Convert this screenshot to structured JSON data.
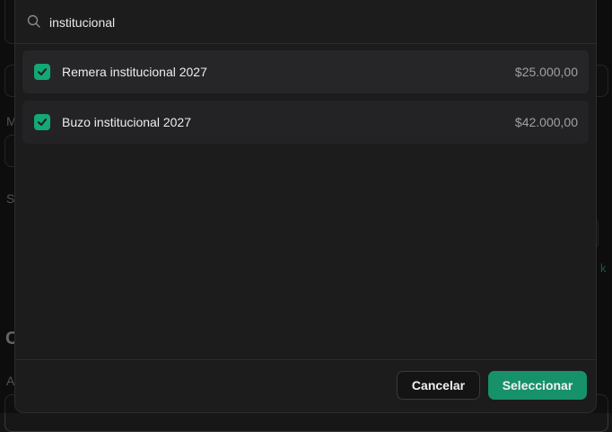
{
  "search": {
    "value": "institucional",
    "icon": "search-icon"
  },
  "items": [
    {
      "name": "Remera institucional 2027",
      "price": "$25.000,00",
      "checked": true
    },
    {
      "name": "Buzo institucional 2027",
      "price": "$42.000,00",
      "checked": true
    }
  ],
  "footer": {
    "cancel_label": "Cancelar",
    "select_label": "Seleccionar"
  },
  "background": {
    "label_m": "M",
    "label_s": "S",
    "label_c": "C",
    "label_a": "A",
    "accent_fragment": "k"
  },
  "colors": {
    "accent": "#17916a",
    "checkbox": "#13a876"
  }
}
